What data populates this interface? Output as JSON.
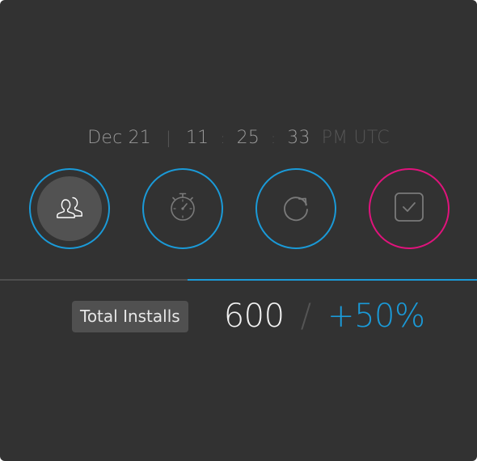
{
  "datetime": {
    "date": "Dec 21",
    "separator": "|",
    "hours": "11",
    "minutes": "25",
    "seconds": "33",
    "colon": ":",
    "suffix": "PM UTC"
  },
  "icons": [
    {
      "name": "users-icon",
      "active": true,
      "ring_color": "#1a9ad8"
    },
    {
      "name": "stopwatch-icon",
      "active": false,
      "ring_color": "#1a9ad8"
    },
    {
      "name": "refresh-icon",
      "active": false,
      "ring_color": "#1a9ad8"
    },
    {
      "name": "checkbox-icon",
      "active": false,
      "ring_color": "#e0137c"
    }
  ],
  "progress": {
    "fraction": 0.607,
    "color": "#1a9ad8"
  },
  "stats": {
    "label": "Total Installs",
    "value": "600",
    "slash": "/",
    "change": "+50%"
  },
  "colors": {
    "background": "#323232",
    "accent_blue": "#1a9ad8",
    "accent_pink": "#e0137c"
  }
}
